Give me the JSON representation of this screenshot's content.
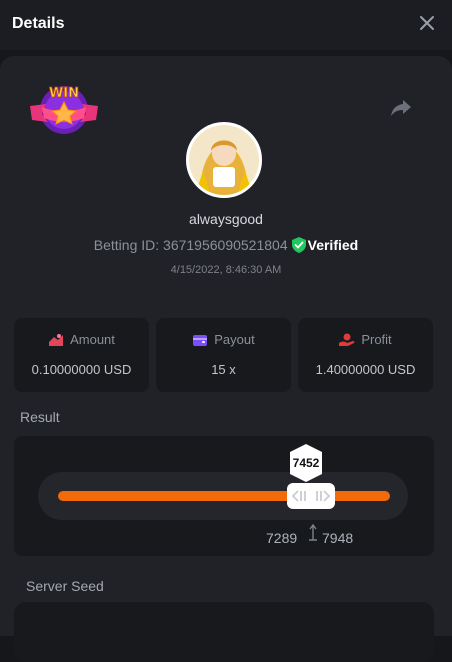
{
  "header": {
    "title": "Details"
  },
  "icons": {
    "close": "close-icon",
    "share": "share-arrow-icon",
    "badge": "win-badge-icon",
    "verified": "shield-check-icon"
  },
  "colors": {
    "accent": "#f36a0a",
    "verified": "#22c55e",
    "amount_icon": "#e2455c",
    "payout_icon": "#7b4dff",
    "profit_icon": "#e03b3b"
  },
  "badge": {
    "text": "WIN"
  },
  "user": {
    "name": "alwaysgood",
    "betting_label": "Betting ID: 3671956090521804",
    "verified_label": "Verified",
    "timestamp": "4/15/2022, 8:46:30 AM"
  },
  "stats": [
    {
      "label": "Amount",
      "value": "0.10000000 USD"
    },
    {
      "label": "Payout",
      "value": "15 x"
    },
    {
      "label": "Profit",
      "value": "1.40000000 USD"
    }
  ],
  "result": {
    "label": "Result",
    "value": "7452",
    "range_low": "7289",
    "range_high": "7948"
  },
  "server_seed": {
    "label": "Server Seed"
  }
}
